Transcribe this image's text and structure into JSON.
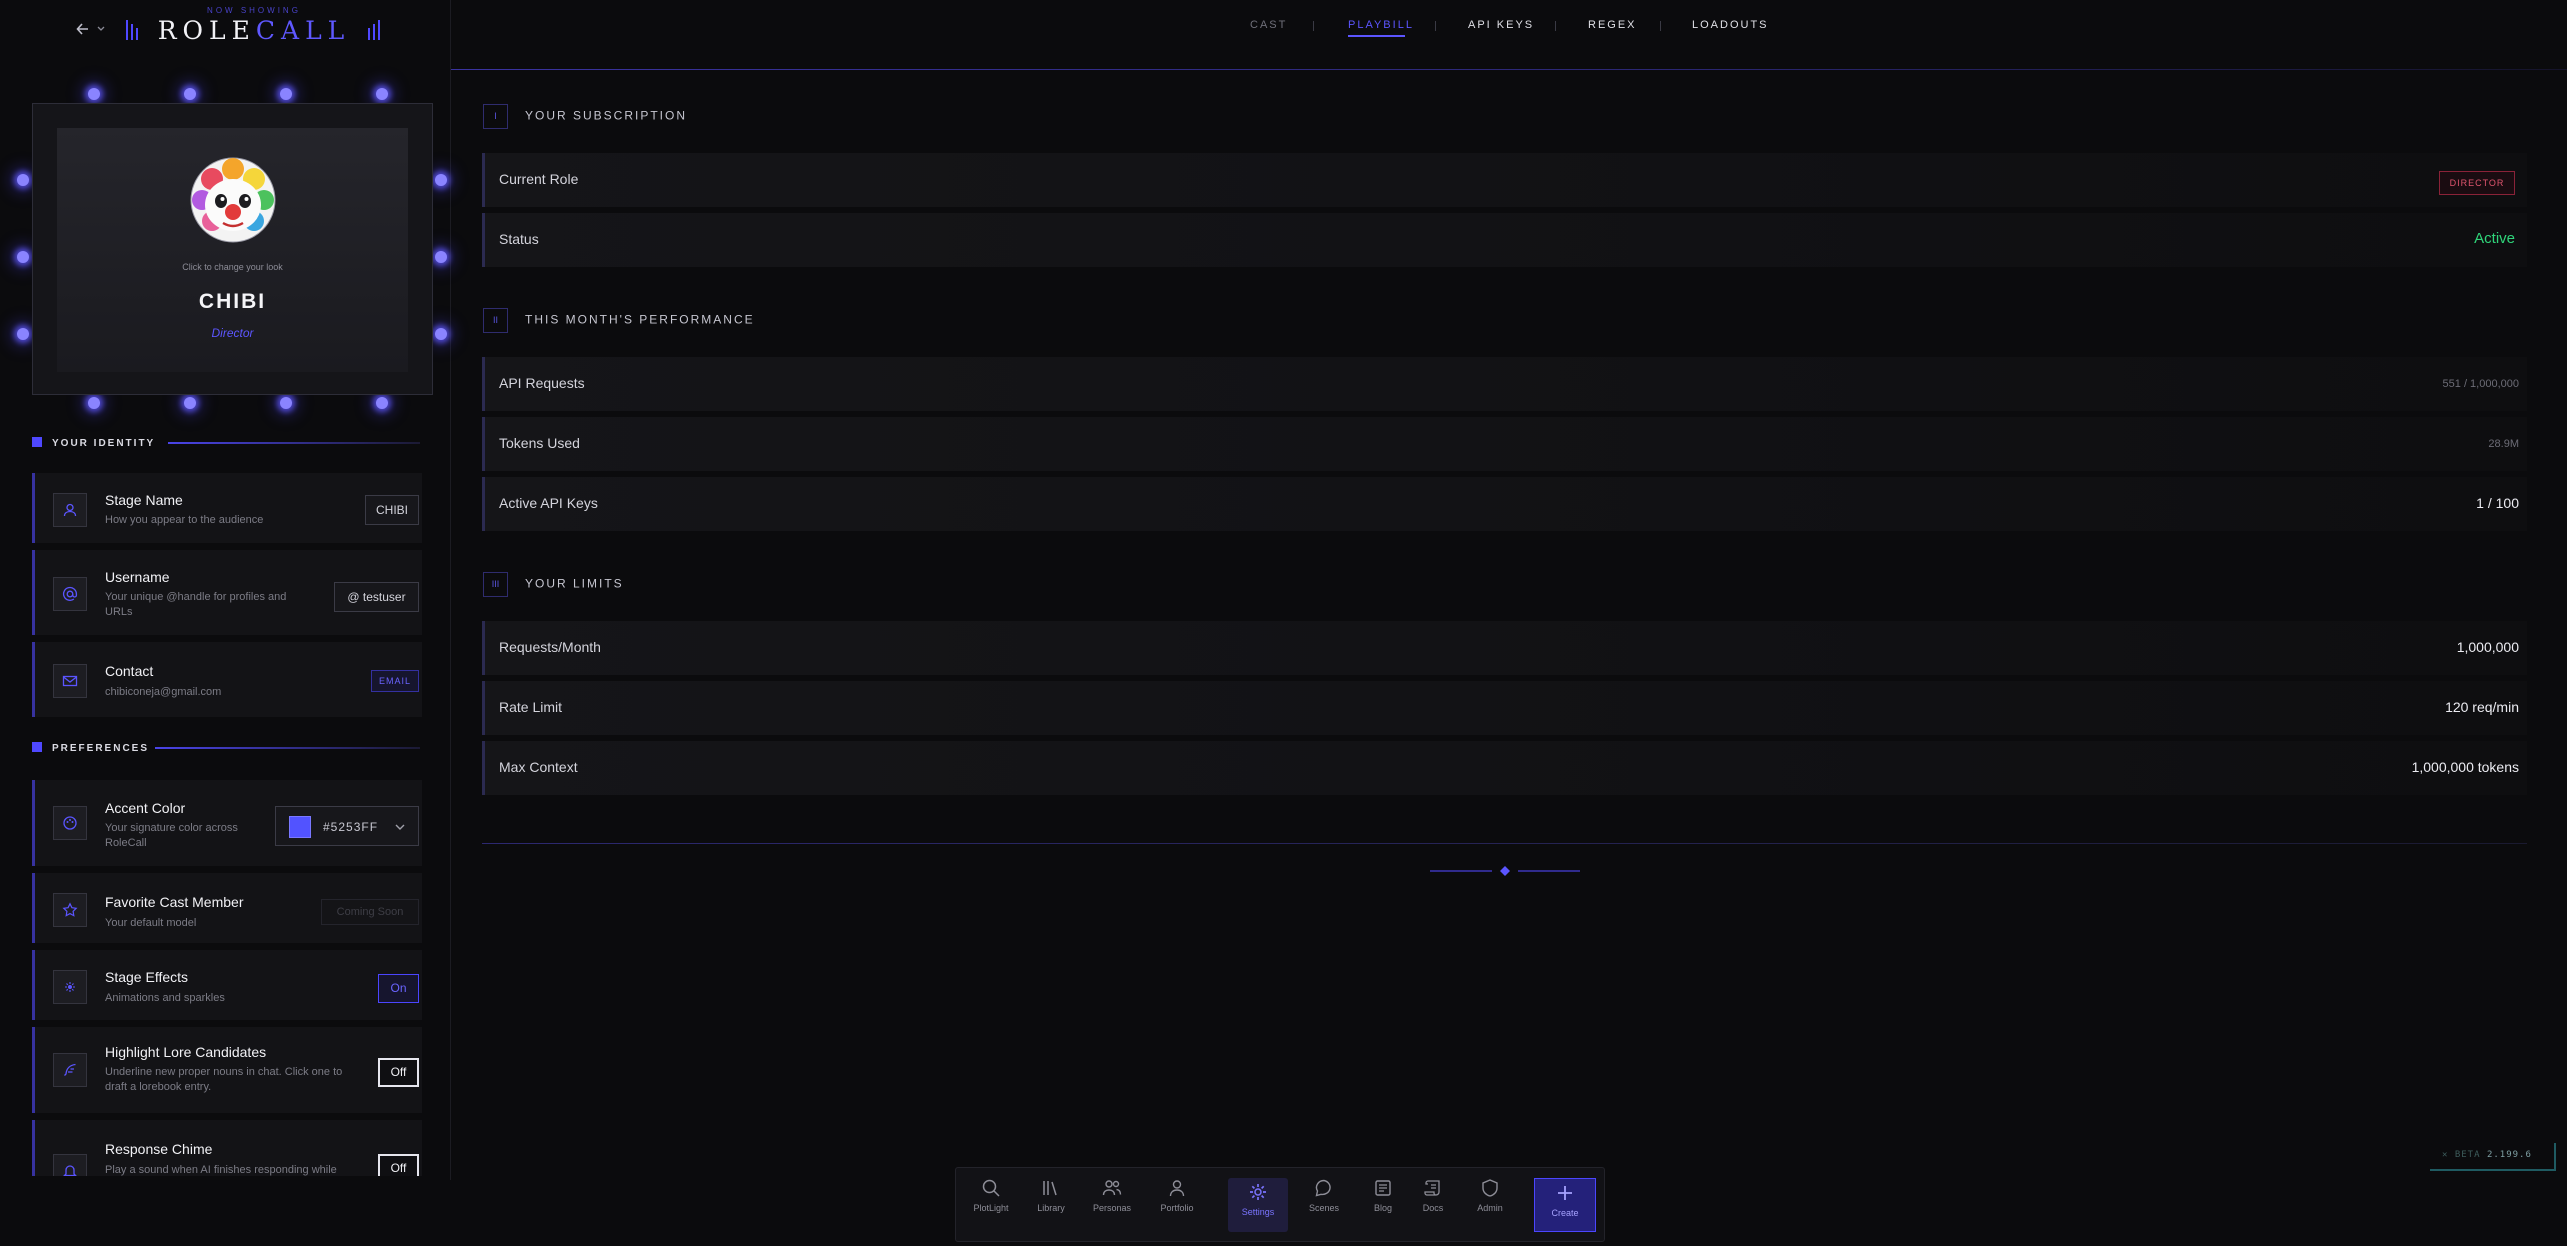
{
  "header": {
    "logo_top": "NOW SHOWING",
    "logo_role": "ROLE",
    "logo_call": "CALL",
    "nav": [
      {
        "label": "CAST"
      },
      {
        "label": "PLAYBILL"
      },
      {
        "label": "API KEYS"
      },
      {
        "label": "REGEX"
      },
      {
        "label": "LOADOUTS"
      }
    ],
    "active_tab": "PLAYBILL"
  },
  "profile": {
    "change_hint": "Click to change your look",
    "name": "CHIBI",
    "role": "Director"
  },
  "identity": {
    "heading": "YOUR IDENTITY",
    "stage_name": {
      "title": "Stage Name",
      "desc": "How you appear to the audience",
      "value": "CHIBI"
    },
    "username": {
      "title": "Username",
      "desc": "Your unique @handle for profiles and URLs",
      "value": "@ testuser"
    },
    "contact": {
      "title": "Contact",
      "desc": "chibiconeja@gmail.com",
      "badge": "EMAIL"
    }
  },
  "preferences": {
    "heading": "PREFERENCES",
    "accent": {
      "title": "Accent Color",
      "desc": "Your signature color across RoleCall",
      "value": "#5253FF",
      "swatch": "#5253FF"
    },
    "favorite": {
      "title": "Favorite Cast Member",
      "desc": "Your default model",
      "value": "Coming Soon"
    },
    "effects": {
      "title": "Stage Effects",
      "desc": "Animations and sparkles",
      "value": "On"
    },
    "lore": {
      "title": "Highlight Lore Candidates",
      "desc": "Underline new proper nouns in chat. Click one to draft a lorebook entry.",
      "value": "Off"
    },
    "chime": {
      "title": "Response Chime",
      "desc": "Play a sound when AI finishes responding while",
      "value": "Off"
    }
  },
  "subscription": {
    "num": "I",
    "heading": "YOUR SUBSCRIPTION",
    "rows": [
      {
        "label": "Current Role",
        "value": "DIRECTOR"
      },
      {
        "label": "Status",
        "value": "Active"
      }
    ]
  },
  "performance": {
    "num": "II",
    "heading": "THIS MONTH'S PERFORMANCE",
    "rows": [
      {
        "label": "API Requests",
        "value": "551 / 1,000,000"
      },
      {
        "label": "Tokens Used",
        "value": "28.9M"
      },
      {
        "label": "Active API Keys",
        "value": "1 / 100"
      }
    ]
  },
  "limits": {
    "num": "III",
    "heading": "YOUR LIMITS",
    "rows": [
      {
        "label": "Requests/Month",
        "value": "1,000,000"
      },
      {
        "label": "Rate Limit",
        "value": "120 req/min"
      },
      {
        "label": "Max Context",
        "value": "1,000,000 tokens"
      }
    ]
  },
  "dock": [
    {
      "label": "PlotLight",
      "icon": "search-icon"
    },
    {
      "label": "Library",
      "icon": "library-icon"
    },
    {
      "label": "Personas",
      "icon": "users-icon"
    },
    {
      "label": "Portfolio",
      "icon": "user-icon"
    },
    {
      "label": "Settings",
      "icon": "gear-icon"
    },
    {
      "label": "Scenes",
      "icon": "chat-icon"
    },
    {
      "label": "Blog",
      "icon": "newspaper-icon"
    },
    {
      "label": "Docs",
      "icon": "scroll-icon"
    },
    {
      "label": "Admin",
      "icon": "shield-icon"
    },
    {
      "label": "Create",
      "icon": "plus-icon"
    }
  ],
  "beta": {
    "label": "BETA",
    "version": "2.199.6"
  },
  "colors": {
    "accent": "#5253FF",
    "active_green": "#2FD57A",
    "director_red": "#E0556E"
  }
}
